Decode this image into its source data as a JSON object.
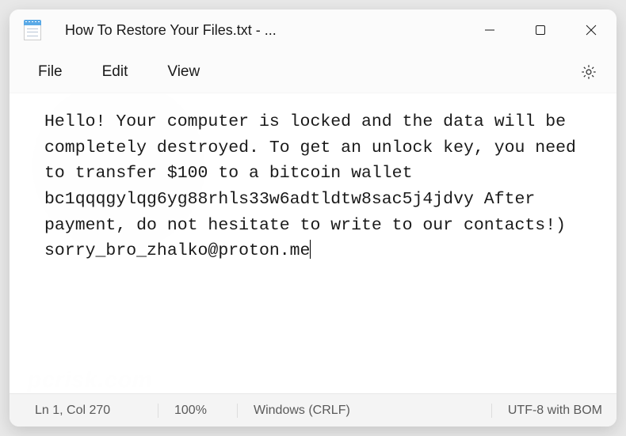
{
  "titlebar": {
    "title": "How To Restore Your Files.txt - ..."
  },
  "menubar": {
    "file": "File",
    "edit": "Edit",
    "view": "View"
  },
  "content": {
    "body": "Hello! Your computer is locked and the data will be completely destroyed. To get an unlock key, you need to transfer $100 to a bitcoin wallet bc1qqqgylqg6yg88rhls33w6adtldtw8sac5j4jdvy After payment, do not hesitate to write to our contacts!) sorry_bro_zhalko@proton.me"
  },
  "statusbar": {
    "position": "Ln 1, Col 270",
    "zoom": "100%",
    "line_ending": "Windows (CRLF)",
    "encoding": "UTF-8 with BOM"
  }
}
